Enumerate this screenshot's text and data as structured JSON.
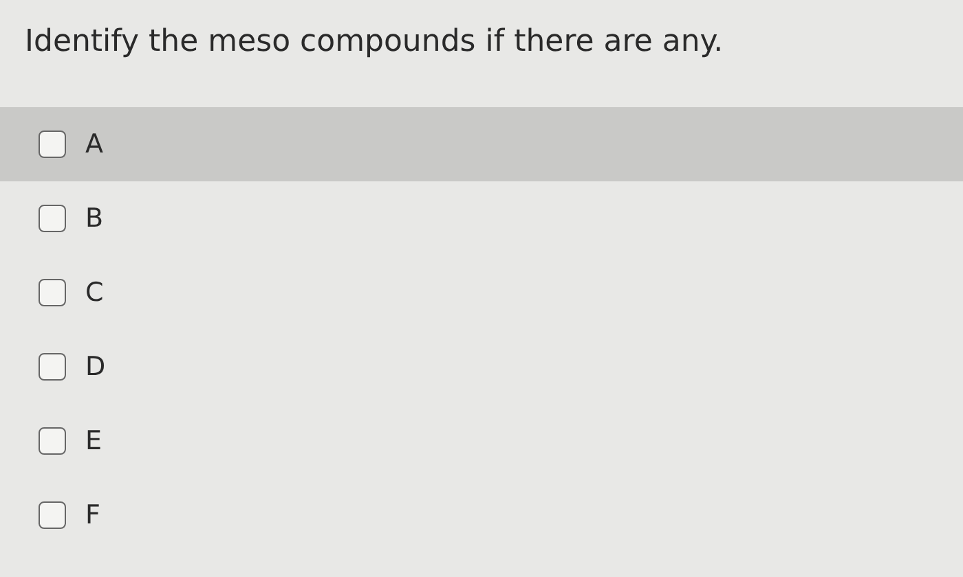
{
  "question": "Identify the meso compounds if there are any.",
  "options": [
    {
      "label": "A",
      "checked": false,
      "highlighted": true
    },
    {
      "label": "B",
      "checked": false,
      "highlighted": false
    },
    {
      "label": "C",
      "checked": false,
      "highlighted": false
    },
    {
      "label": "D",
      "checked": false,
      "highlighted": false
    },
    {
      "label": "E",
      "checked": false,
      "highlighted": false
    },
    {
      "label": "F",
      "checked": false,
      "highlighted": false
    }
  ]
}
